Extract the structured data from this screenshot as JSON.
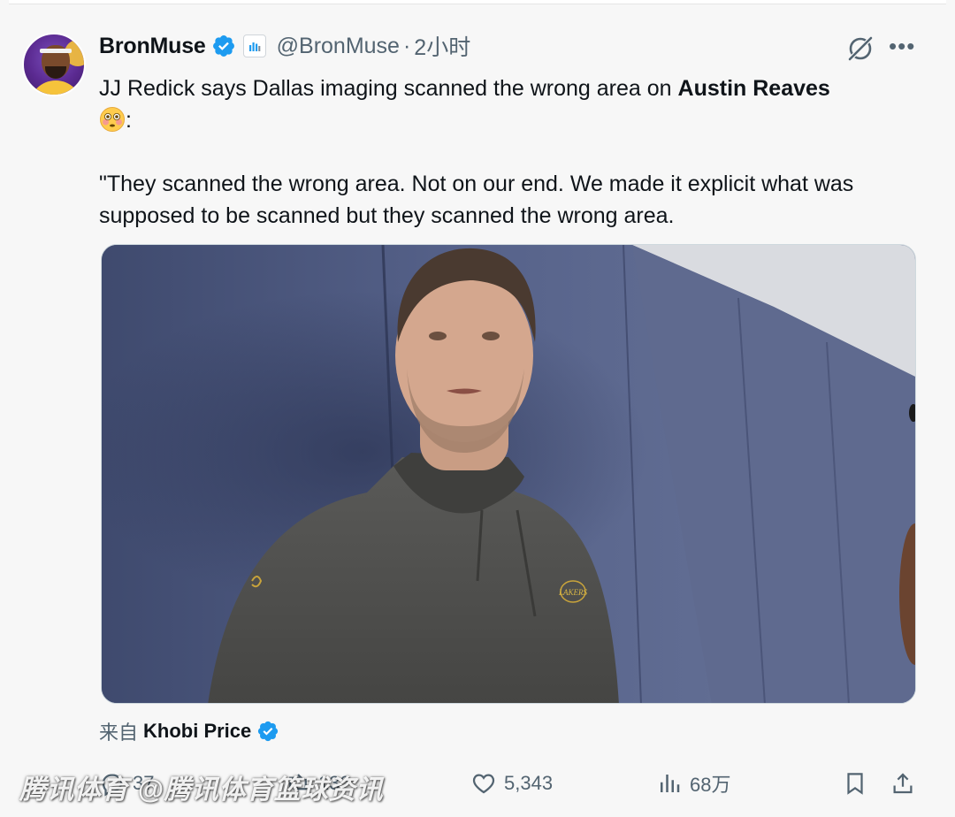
{
  "tweet": {
    "author_name": "BronMuse",
    "handle": "@BronMuse",
    "separator": "·",
    "time": "2小时",
    "text_line1": "JJ Redick says Dallas imaging scanned the wrong area on ",
    "text_bold": "Austin Reaves",
    "text_after_emoji": ":",
    "quote": "\"They scanned the wrong area. Not on our end. We made it explicit what was supposed to be scanned but they scanned the wrong area.",
    "emoji": "flushed-face-emoji",
    "media_logo_text": "LAKERS"
  },
  "source": {
    "label": "来自",
    "name": "Khobi Price"
  },
  "actions": {
    "reply_count": "37",
    "retweet_count": "132",
    "like_count": "5,343",
    "views_count": "68万"
  },
  "watermark": "腾讯体育 @腾讯体育篮球资讯",
  "colors": {
    "verified": "#1d9bf0",
    "secondary_text": "#536471",
    "background": "#f7f7f7",
    "wall": "#4a5578"
  },
  "icons": [
    "verified-badge-icon",
    "affiliate-chart-icon",
    "grok-icon",
    "more-icon",
    "reply-icon",
    "retweet-icon",
    "like-icon",
    "views-icon",
    "bookmark-icon",
    "share-icon"
  ]
}
